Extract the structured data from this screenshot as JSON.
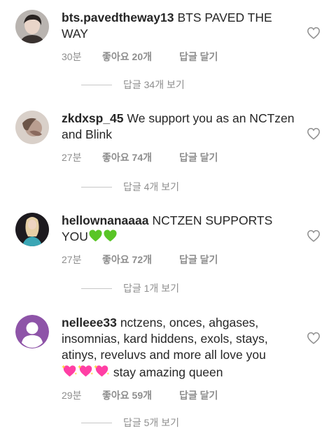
{
  "colors": {
    "text": "#262626",
    "muted": "#8e8e8e",
    "green_heart": "#59c526",
    "pink_heart": "#ff3fa4"
  },
  "comments": [
    {
      "username": "bts.pavedtheway13",
      "text": "BTS PAVED THE WAY",
      "time": "30분",
      "likes": "좋아요 20개",
      "reply": "답글 달기",
      "thread": "답글 34개 보기"
    },
    {
      "username": "zkdxsp_45",
      "text": "We support you as an NCTzen and Blink",
      "time": "27분",
      "likes": "좋아요 74개",
      "reply": "답글 달기",
      "thread": "답글 4개 보기"
    },
    {
      "username": "hellownanaaaa",
      "text": "NCTZEN SUPPORTS YOU",
      "emoji": "green-heart x2",
      "time": "27분",
      "likes": "좋아요 72개",
      "reply": "답글 달기",
      "thread": "답글 1개 보기"
    },
    {
      "username": "nelleee33",
      "text": "nctzens, onces, ahgases, insomnias, kard hiddens, exols, stays, atinys, reveluvs and more all love you",
      "text_after_emoji": "stay amazing queen",
      "emoji": "sparkling-heart x3",
      "time": "29분",
      "likes": "좋아요 59개",
      "reply": "답글 달기",
      "thread": "답글 5개 보기"
    }
  ]
}
